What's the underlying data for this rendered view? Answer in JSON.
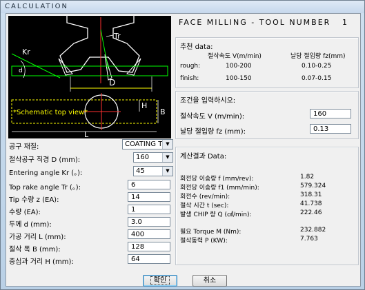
{
  "window": {
    "title": "CALCULATION"
  },
  "header": {
    "heading": "FACE MILLING - TOOL NUMBER",
    "number": "1"
  },
  "schematic": {
    "label_tr": "Tr",
    "label_kr": "Kr",
    "label_d_small": "d",
    "label_D": "D",
    "label_H": "H",
    "label_B": "B",
    "label_L": "L",
    "caption": "*Schematic top view*"
  },
  "form": {
    "tool_material_label": "공구 재질:",
    "tool_material_value": "COATING TI",
    "diameter_label": "절삭공구 직경 D (mm):",
    "diameter_value": "160",
    "entering_angle_label": "Entering angle Kr (。):",
    "entering_angle_value": "45",
    "top_rake_label": "Top rake angle Tr (。):",
    "top_rake_value": "6",
    "tip_count_label": "Tip 수량 z (EA):",
    "tip_count_value": "14",
    "quantity_label": "수량 (EA):",
    "quantity_value": "1",
    "thickness_label": "두께 d (mm):",
    "thickness_value": "3.0",
    "length_label": "가공 거리 L (mm):",
    "length_value": "400",
    "width_label": "절삭 폭 B (mm):",
    "width_value": "128",
    "center_dist_label": "중심과 거리 H (mm):",
    "center_dist_value": "64"
  },
  "recommended": {
    "title": "추천 data:",
    "col_speed": "절삭속도 V(m/min)",
    "col_feed": "날당 절입량 fz(mm)",
    "rows": [
      {
        "name": "rough:",
        "speed": "100-200",
        "feed": "0.10-0.25"
      },
      {
        "name": "finish:",
        "speed": "100-150",
        "feed": "0.07-0.15"
      }
    ]
  },
  "conditions": {
    "title": "조건을 입력하시오:",
    "speed_label": "절삭속도 V (m/min):",
    "speed_value": "160",
    "feed_label": "날당 절입량 fz (mm):",
    "feed_value": "0.13"
  },
  "results": {
    "title": "계산결과 Data:",
    "rows": [
      {
        "label": "회전당 이송량 f (mm/rev):",
        "value": "1.82"
      },
      {
        "label": "회전당 이송량 f1 (mm/min):",
        "value": "579.324"
      },
      {
        "label": "회전수 (rev/min):",
        "value": "318.31"
      },
      {
        "label": "절삭 시간 t (sec):",
        "value": "41.738"
      },
      {
        "label": "발생 CHIP 량 Q (㎤/min):",
        "value": "222.46"
      }
    ],
    "rows2": [
      {
        "label": "필요 Torque M (Nm):",
        "value": "232.882"
      },
      {
        "label": "절삭동력 P (KW):",
        "value": "7.763"
      }
    ]
  },
  "buttons": {
    "ok": "확인",
    "cancel": "취소"
  }
}
